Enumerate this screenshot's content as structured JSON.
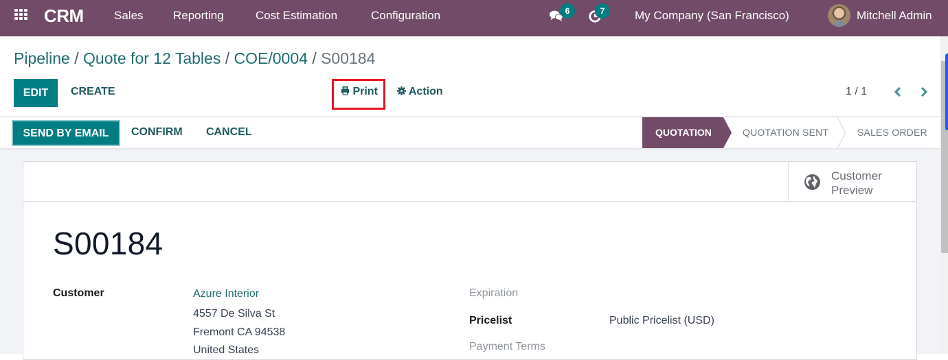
{
  "navbar": {
    "app_name": "CRM",
    "menu": [
      "Sales",
      "Reporting",
      "Cost Estimation",
      "Configuration"
    ],
    "messages_badge": "6",
    "activities_badge": "7",
    "company": "My Company (San Francisco)",
    "user": "Mitchell Admin",
    "colors": {
      "bar": "#714b67",
      "badge": "#017e84"
    }
  },
  "breadcrumb": {
    "items": [
      "Pipeline",
      "Quote for 12 Tables",
      "COE/0004"
    ],
    "current": "S00184",
    "separator": "/"
  },
  "control": {
    "edit_label": "EDIT",
    "create_label": "CREATE",
    "print_label": "Print",
    "action_label": "Action",
    "pager": "1 / 1"
  },
  "statusbar": {
    "buttons": [
      "SEND BY EMAIL",
      "CONFIRM",
      "CANCEL"
    ],
    "stages": [
      {
        "label": "QUOTATION",
        "active": true
      },
      {
        "label": "QUOTATION SENT",
        "active": false
      },
      {
        "label": "SALES ORDER",
        "active": false
      }
    ]
  },
  "sheet": {
    "smart_button": {
      "line1": "Customer",
      "line2": "Preview",
      "icon": "globe-icon"
    },
    "title": "S00184",
    "fields": {
      "customer_label": "Customer",
      "customer_name": "Azure Interior",
      "address_line1": "4557 De Silva St",
      "address_line2": "Fremont CA 94538",
      "address_line3": "United States",
      "expiration_label": "Expiration",
      "pricelist_label": "Pricelist",
      "pricelist_value": "Public Pricelist (USD)",
      "payment_terms_label": "Payment Terms"
    }
  }
}
